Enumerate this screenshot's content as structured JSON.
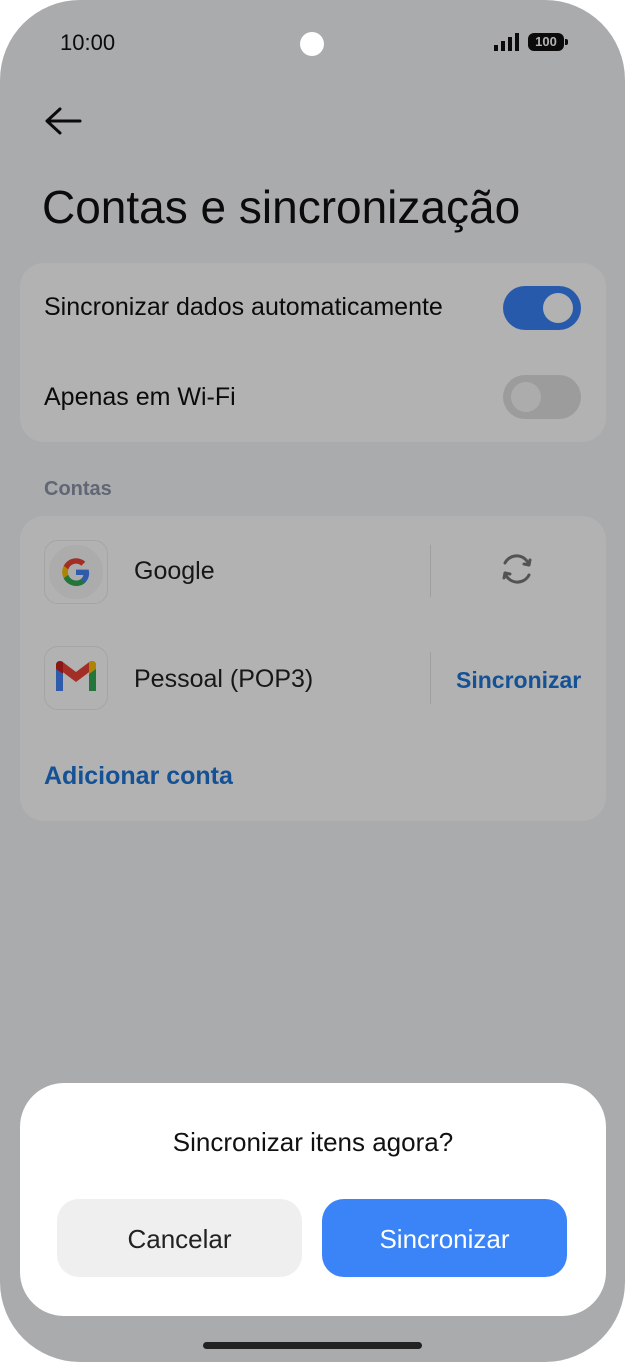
{
  "status_bar": {
    "time": "10:00",
    "battery": "100"
  },
  "header": {
    "back_icon": "arrow-left-icon",
    "title": "Contas e sincronização"
  },
  "settings": {
    "auto_sync": {
      "label": "Sincronizar dados automaticamente",
      "enabled": true
    },
    "wifi_only": {
      "label": "Apenas em Wi-Fi",
      "enabled": false
    }
  },
  "accounts": {
    "section_label": "Contas",
    "items": [
      {
        "name": "Google",
        "icon": "google-icon",
        "action_icon": "sync-icon"
      },
      {
        "name": "Pessoal (POP3)",
        "icon": "gmail-icon",
        "action_label": "Sincronizar"
      }
    ],
    "add_label": "Adicionar conta"
  },
  "dialog": {
    "title": "Sincronizar itens agora?",
    "cancel_label": "Cancelar",
    "confirm_label": "Sincronizar"
  },
  "colors": {
    "accent": "#3a84f7",
    "link": "#1f74d6",
    "scrim": "rgba(0,0,0,0.3)"
  }
}
